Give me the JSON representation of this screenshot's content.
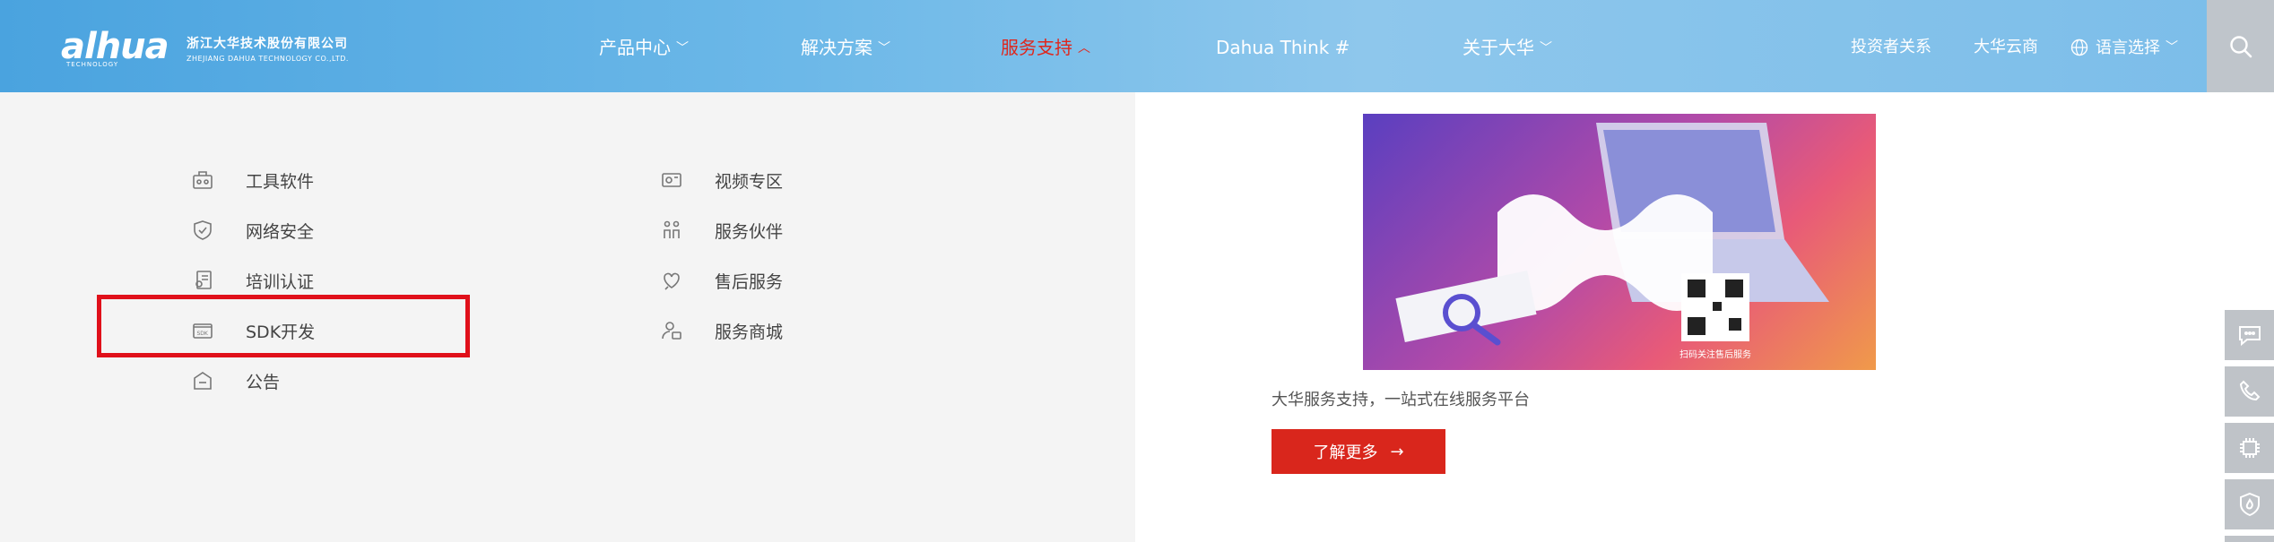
{
  "brand": {
    "logo_mark": "alhua",
    "logo_sub": "TECHNOLOGY",
    "name_cn": "浙江大华技术股份有限公司",
    "name_en": "ZHEJIANG DAHUA TECHNOLOGY CO.,LTD."
  },
  "nav": [
    {
      "label": "产品中心",
      "active": false
    },
    {
      "label": "解决方案",
      "active": false
    },
    {
      "label": "服务支持",
      "active": true
    },
    {
      "label": "Dahua Think #",
      "active": false
    },
    {
      "label": "关于大华",
      "active": false
    }
  ],
  "header_right": {
    "investor": "投资者关系",
    "cloud": "大华云商",
    "language": "语言选择"
  },
  "menu": {
    "col1": [
      {
        "label": "工具软件",
        "icon": "toolbox-icon"
      },
      {
        "label": "网络安全",
        "icon": "shield-check-icon"
      },
      {
        "label": "培训认证",
        "icon": "certificate-icon"
      },
      {
        "label": "SDK开发",
        "icon": "sdk-folder-icon"
      },
      {
        "label": "公告",
        "icon": "announcement-icon"
      }
    ],
    "col2": [
      {
        "label": "视频专区",
        "icon": "video-camera-icon"
      },
      {
        "label": "服务伙伴",
        "icon": "partners-icon"
      },
      {
        "label": "售后服务",
        "icon": "after-sales-icon"
      },
      {
        "label": "服务商城",
        "icon": "service-mall-icon"
      }
    ]
  },
  "promo": {
    "caption": "大华服务支持，一站式在线服务平台",
    "button": "了解更多",
    "qr_text": "扫码关注售后服务"
  },
  "colors": {
    "accent_red": "#d9261c",
    "header_blue": "#6cb8e8",
    "active_nav": "#e0261c"
  }
}
